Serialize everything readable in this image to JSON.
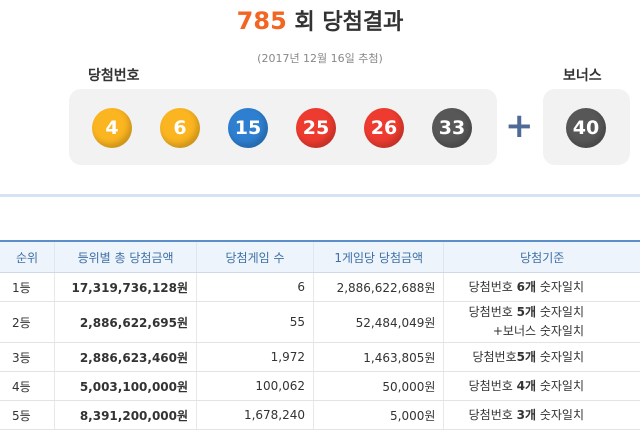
{
  "header": {
    "round": "785",
    "round_suffix": "회 당첨결과",
    "date": "(2017년 12월 16일 추첨)"
  },
  "labels": {
    "winning": "당첨번호",
    "bonus": "보너스"
  },
  "balls": [
    {
      "number": "4",
      "color": "#fbb520"
    },
    {
      "number": "6",
      "color": "#fbb520"
    },
    {
      "number": "15",
      "color": "#2f7fd1"
    },
    {
      "number": "25",
      "color": "#ee3b2f"
    },
    {
      "number": "26",
      "color": "#ee3b2f"
    },
    {
      "number": "33",
      "color": "#575757"
    }
  ],
  "bonus_ball": {
    "number": "40",
    "color": "#575757"
  },
  "plus_sign": "+",
  "table": {
    "headers": [
      "순위",
      "등위별 총 당첨금액",
      "당첨게임 수",
      "1게임당 당첨금액",
      "당첨기준"
    ],
    "rows": [
      {
        "rank": "1등",
        "total": "17,319,736,128원",
        "count": "6",
        "per_game": "2,886,622,688원",
        "crit_pre": "당첨번호 ",
        "crit_bold": "6개",
        "crit_post": " 숫자일치",
        "crit_line2": ""
      },
      {
        "rank": "2등",
        "total": "2,886,622,695원",
        "count": "55",
        "per_game": "52,484,049원",
        "crit_pre": "당첨번호 ",
        "crit_bold": "5개",
        "crit_post": " 숫자일치",
        "crit_line2": "+보너스 숫자일치"
      },
      {
        "rank": "3등",
        "total": "2,886,623,460원",
        "count": "1,972",
        "per_game": "1,463,805원",
        "crit_pre": "당첨번호",
        "crit_bold": "5개",
        "crit_post": " 숫자일치",
        "crit_line2": ""
      },
      {
        "rank": "4등",
        "total": "5,003,100,000원",
        "count": "100,062",
        "per_game": "50,000원",
        "crit_pre": "당첨번호 ",
        "crit_bold": "4개",
        "crit_post": " 숫자일치",
        "crit_line2": ""
      },
      {
        "rank": "5등",
        "total": "8,391,200,000원",
        "count": "1,678,240",
        "per_game": "5,000원",
        "crit_pre": "당첨번호 ",
        "crit_bold": "3개",
        "crit_post": " 숫자일치",
        "crit_line2": ""
      }
    ]
  }
}
